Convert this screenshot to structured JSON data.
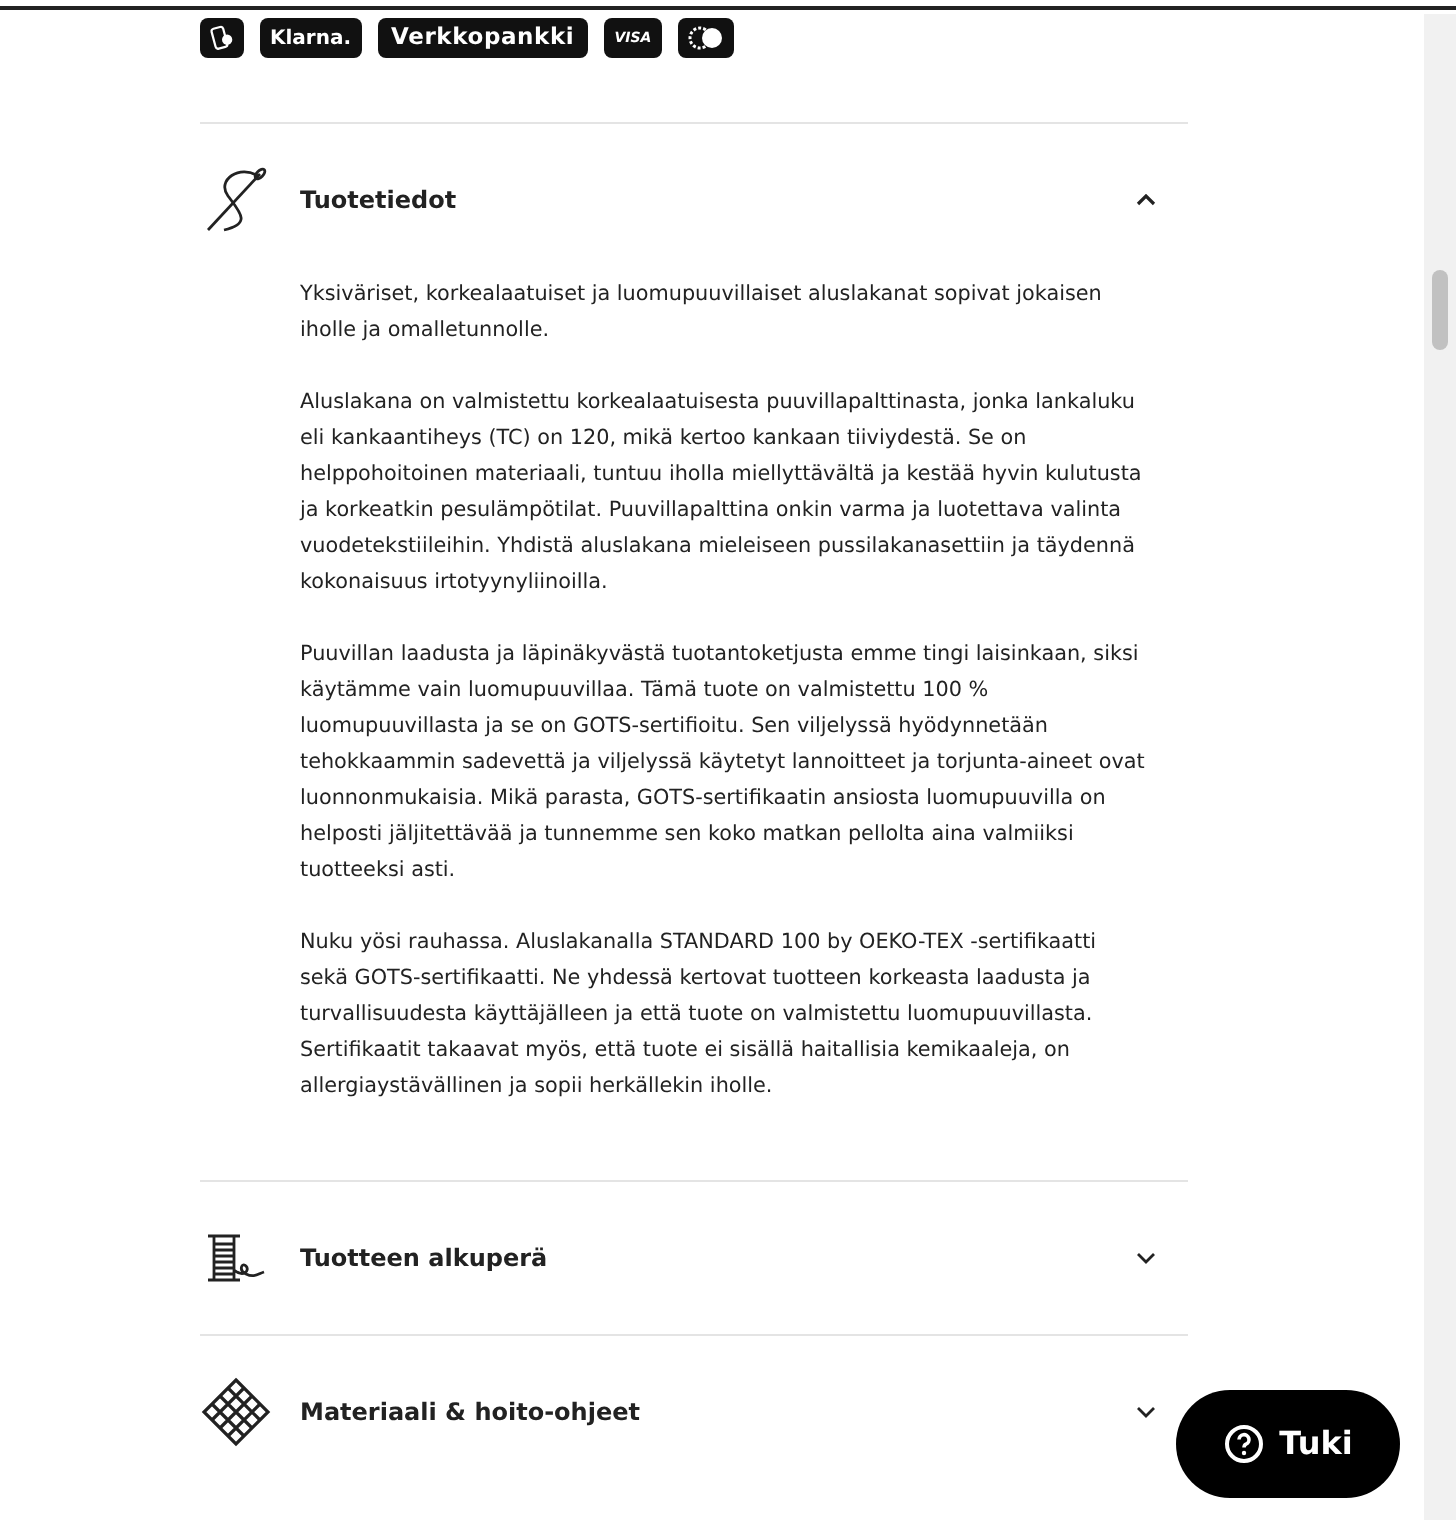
{
  "payment_methods": [
    "Klarna.",
    "Verkkopankki",
    "VISA"
  ],
  "accordion": [
    {
      "title": "Tuotetiedot",
      "expanded": true,
      "paragraphs": [
        "Yksiväriset, korkealaatuiset ja luomupuuvillaiset aluslakanat sopivat jokaisen iholle ja omalletunnolle.",
        "Aluslakana on valmistettu korkealaatuisesta puuvillapalttinasta, jonka lankaluku eli kankaantiheys (TC) on 120, mikä kertoo kankaan tiiviydestä. Se on helppohoitoinen materiaali, tuntuu iholla miellyttävältä ja kestää hyvin kulutusta ja korkeatkin pesulämpötilat. Puuvillapalttina onkin varma ja luotettava valinta vuodetekstiileihin. Yhdistä aluslakana mieleiseen pussilakanasettiin ja täydennä kokonaisuus irtotyynyliinoilla.",
        "Puuvillan laadusta ja läpinäkyvästä tuotantoketjusta emme tingi laisinkaan, siksi käytämme vain luomupuuvillaa. Tämä tuote on valmistettu 100 % luomupuuvillasta ja se on GOTS-sertifioitu. Sen viljelyssä hyödynnetään tehokkaammin sadevettä ja viljelyssä käytetyt lannoitteet ja torjunta-aineet ovat luonnonmukaisia. Mikä parasta, GOTS-sertifikaatin ansiosta luomupuuvilla on helposti jäljitettävää ja tunnemme sen koko matkan pellolta aina valmiiksi tuotteeksi asti.",
        "Nuku yösi rauhassa. Aluslakanalla STANDARD 100 by OEKO-TEX -sertifikaatti sekä GOTS-sertifikaatti. Ne yhdessä kertovat tuotteen korkeasta laadusta ja turvallisuudesta käyttäjälleen ja että tuote on valmistettu luomupuuvillasta. Sertifikaatit takaavat myös, että tuote ei sisällä haitallisia kemikaaleja, on allergiaystävällinen ja sopii herkällekin iholle."
      ]
    },
    {
      "title": "Tuotteen alkuperä",
      "expanded": false
    },
    {
      "title": "Materiaali & hoito-ohjeet",
      "expanded": false
    }
  ],
  "help_button": {
    "label": "Tuki"
  }
}
